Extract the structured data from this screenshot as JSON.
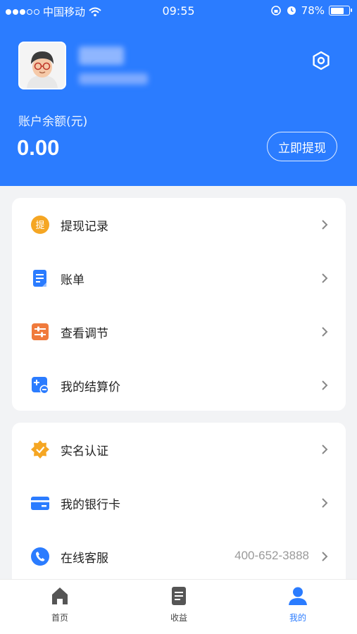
{
  "status_bar": {
    "carrier": "中国移动",
    "time": "09:55",
    "battery": "78%",
    "battery_level": 0.78
  },
  "profile": {
    "name": "**** ",
    "subtitle": "*********"
  },
  "balance": {
    "label": "账户余额(元)",
    "value": "0.00",
    "withdraw_button": "立即提现"
  },
  "menu_group_1": [
    {
      "label": "提现记录",
      "icon": "withdraw-record-icon",
      "color": "#f5a623"
    },
    {
      "label": "账单",
      "icon": "bill-icon",
      "color": "#2b7cff"
    },
    {
      "label": "查看调节",
      "icon": "adjust-icon",
      "color": "#f07a3c"
    },
    {
      "label": "我的结算价",
      "icon": "settlement-price-icon",
      "color": "#2b7cff"
    }
  ],
  "menu_group_2": [
    {
      "label": "实名认证",
      "icon": "verified-badge-icon",
      "color": "#f5a623"
    },
    {
      "label": "我的银行卡",
      "icon": "bank-card-icon",
      "color": "#2b7cff"
    },
    {
      "label": "在线客服",
      "icon": "phone-icon",
      "color": "#2b7cff",
      "value": "400-652-3888"
    }
  ],
  "tabbar": [
    {
      "label": "首页",
      "icon": "home-icon",
      "active": false
    },
    {
      "label": "收益",
      "icon": "earnings-icon",
      "active": false
    },
    {
      "label": "我的",
      "icon": "profile-icon",
      "active": true
    }
  ],
  "colors": {
    "primary": "#2b7cff",
    "background": "#f2f3f5",
    "accent_orange": "#f5a623"
  }
}
